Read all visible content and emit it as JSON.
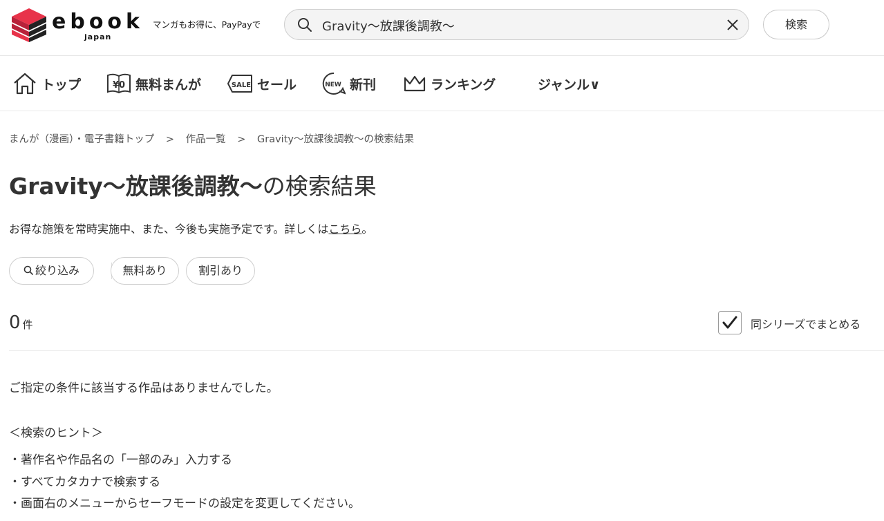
{
  "header": {
    "logo_text": "ebook",
    "logo_sub": "japan",
    "tagline": "マンガもお得に、PayPayで",
    "search_value": "Gravity～放課後調教～",
    "search_button": "検索"
  },
  "nav": {
    "items": [
      {
        "label": "トップ",
        "icon": "home-icon"
      },
      {
        "label": "無料まんが",
        "icon": "free-manga-icon"
      },
      {
        "label": "セール",
        "icon": "sale-tag-icon"
      },
      {
        "label": "新刊",
        "icon": "new-badge-icon"
      },
      {
        "label": "ランキング",
        "icon": "crown-icon"
      },
      {
        "label": "ジャンル∨",
        "icon": ""
      }
    ],
    "sale_icon_text": "SALE",
    "new_icon_text": "NEW",
    "free_icon_text": "¥0"
  },
  "breadcrumb": {
    "items": [
      "まんが（漫画）・電子書籍トップ",
      "作品一覧",
      "Gravity～放課後調教～の検索結果"
    ],
    "separator": ">"
  },
  "page": {
    "title_query": "Gravity～放課後調教～",
    "title_suffix": "の検索結果",
    "notice_text": "お得な施策を常時実施中、また、今後も実施予定です。詳しくは",
    "notice_link": "こちら",
    "notice_end": "。"
  },
  "filters": {
    "narrow": "絞り込み",
    "free": "無料あり",
    "discount": "割引あり"
  },
  "results": {
    "count": "0",
    "unit": "件",
    "series_label": "同シリーズでまとめる",
    "series_checked": true,
    "empty_message": "ご指定の条件に該当する作品はありませんでした。",
    "hint_title": "＜検索のヒント＞",
    "hints": [
      "・著作名や作品名の「一部のみ」入力する",
      "・すべてカタカナで検索する",
      "・画面右のメニューからセーフモードの設定を変更してください。"
    ]
  },
  "colors": {
    "brand_red": "#e8334a",
    "text": "#333333",
    "border": "#cfcfcf"
  }
}
